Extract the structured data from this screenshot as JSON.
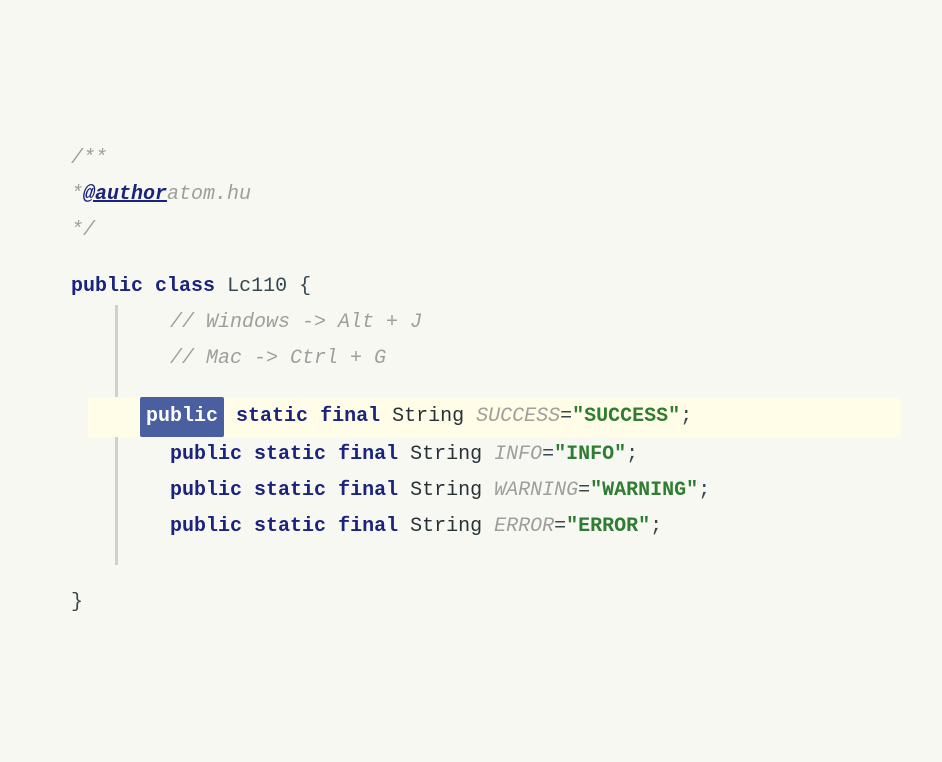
{
  "code": {
    "comment_open": "/**",
    "comment_author_prefix": " * ",
    "comment_author_tag": "@author",
    "comment_author_value": " atom.hu",
    "comment_close": " */",
    "class_keyword1": "public",
    "class_keyword2": "class",
    "class_name": "Lc110",
    "class_open": "{",
    "comment_windows": "// Windows -> Alt + J",
    "comment_mac": "// Mac -> Ctrl + G",
    "line1_kw1": "public",
    "line1_kw2": "static",
    "line1_kw3": "final",
    "line1_type": "String",
    "line1_var": "SUCCESS",
    "line1_eq": " = ",
    "line1_val": "\"SUCCESS\"",
    "line1_semi": ";",
    "line2_kw1": "public",
    "line2_kw2": "static",
    "line2_kw3": "final",
    "line2_type": "String",
    "line2_var": "INFO",
    "line2_eq": " = ",
    "line2_val": "\"INFO\"",
    "line2_semi": ";",
    "line3_kw1": "public",
    "line3_kw2": "static",
    "line3_kw3": "final",
    "line3_type": "String",
    "line3_var": "WARNING",
    "line3_eq": " = ",
    "line3_val": "\"WARNING\"",
    "line3_semi": ";",
    "line4_kw1": "public",
    "line4_kw2": "static",
    "line4_kw3": "final",
    "line4_type": "String",
    "line4_var": "ERROR",
    "line4_eq": " = ",
    "line4_val": "\"ERROR\"",
    "line4_semi": ";",
    "class_close": "}"
  }
}
